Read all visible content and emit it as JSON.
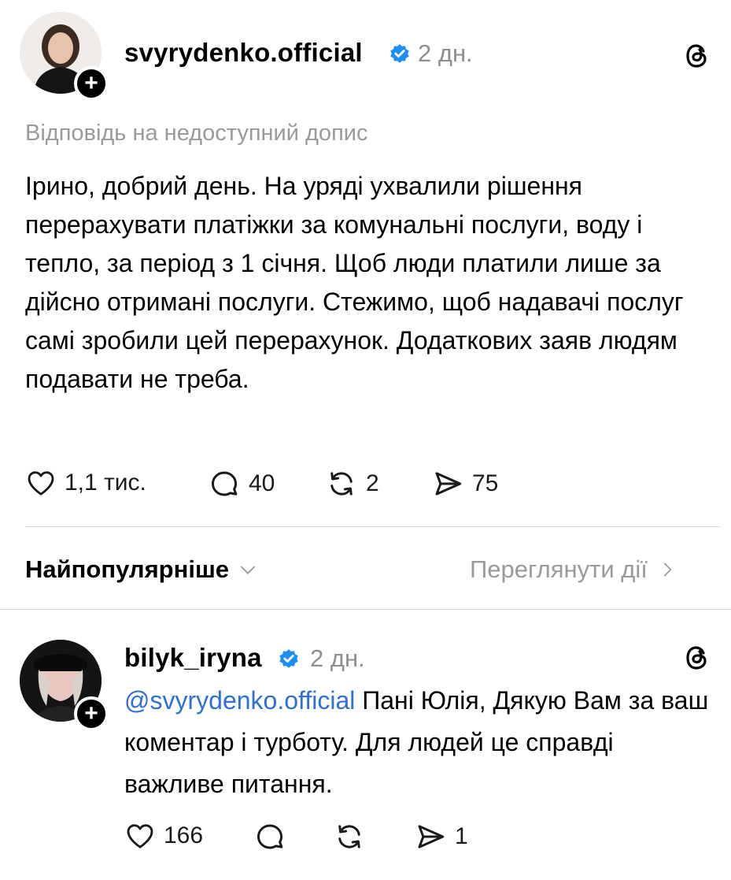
{
  "post": {
    "username": "svyrydenko.official",
    "time": "2 дн.",
    "reply_to": "Відповідь на недоступний допис",
    "text": "Ірино, добрий день. На уряді ухвалили рішення перерахувати платіжки за комунальні послуги, воду і тепло, за період з 1 січня. Щоб люди платили лише за дійсно отримані послуги. Стежимо, щоб надавачі послуг самі зробили цей перерахунок. Додаткових заяв людям подавати не треба.",
    "likes": "1,1 тис.",
    "comments": "40",
    "reposts": "2",
    "shares": "75"
  },
  "sort": {
    "label": "Найпопулярніше",
    "view_activity": "Переглянути дії"
  },
  "reply": {
    "username": "bilyk_iryna",
    "time": "2 дн.",
    "mention": "@svyrydenko.official",
    "text": " Пані Юлія, Дякую Вам за ваш коментар і турботу. Для людей це справді важливе питання.",
    "likes": "166",
    "shares": "1"
  },
  "icons": {
    "verified": "verified-badge-icon",
    "threads": "threads-logo-icon",
    "like": "heart-icon",
    "comment": "comment-icon",
    "repost": "repost-icon",
    "share": "send-icon"
  },
  "colors": {
    "verified": "#1d8ef5",
    "mention": "#2f6fd6",
    "muted": "#8e8e8e"
  }
}
